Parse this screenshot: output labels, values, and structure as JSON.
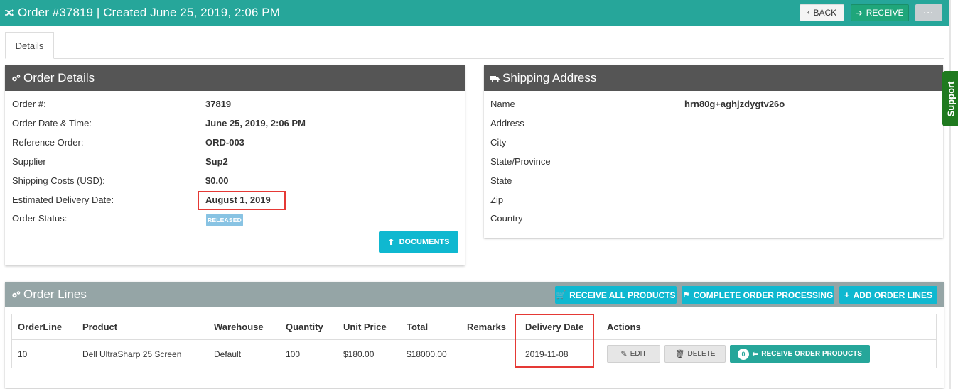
{
  "header": {
    "title": "Order #37819 | Created June 25, 2019, 2:06 PM",
    "back_label": "BACK",
    "receive_label": "RECEIVE",
    "more_label": "···",
    "accent_color": "#26a69a"
  },
  "tabs": [
    {
      "label": "Details"
    }
  ],
  "order_details": {
    "heading": "Order Details",
    "rows": [
      {
        "label": "Order #:",
        "value": "37819"
      },
      {
        "label": "Order Date & Time:",
        "value": "June 25, 2019, 2:06 PM"
      },
      {
        "label": "Reference Order:",
        "value": "ORD-003"
      },
      {
        "label": "Supplier",
        "value": "Sup2"
      },
      {
        "label": "Shipping Costs (USD):",
        "value": "$0.00"
      },
      {
        "label": "Estimated Delivery Date:",
        "value": "August 1, 2019"
      },
      {
        "label": "Order Status:",
        "value": ""
      }
    ],
    "status_badge": "RELEASED",
    "documents_label": "DOCUMENTS"
  },
  "shipping_address": {
    "heading": "Shipping Address",
    "rows": [
      {
        "label": "Name",
        "value": "hrn80g+aghjzdygtv26o"
      },
      {
        "label": "Address",
        "value": ""
      },
      {
        "label": "City",
        "value": ""
      },
      {
        "label": "State/Province",
        "value": ""
      },
      {
        "label": "State",
        "value": ""
      },
      {
        "label": "Zip",
        "value": ""
      },
      {
        "label": "Country",
        "value": ""
      }
    ]
  },
  "order_lines": {
    "heading": "Order Lines",
    "receive_all_label": "RECEIVE ALL PRODUCTS",
    "complete_label": "COMPLETE ORDER PROCESSING",
    "add_lines_label": "ADD ORDER LINES",
    "columns": [
      "OrderLine",
      "Product",
      "Warehouse",
      "Quantity",
      "Unit Price",
      "Total",
      "Remarks",
      "Delivery Date",
      "Actions"
    ],
    "rows": [
      {
        "orderline": "10",
        "product": "Dell UltraSharp 25 Screen",
        "warehouse": "Default",
        "quantity": "100",
        "unit_price": "$180.00",
        "total": "$18000.00",
        "remarks": "",
        "delivery_date": "2019-11-08"
      }
    ],
    "edit_label": "EDIT",
    "delete_label": "DELETE",
    "receive_count": "0",
    "receive_order_products_label": "RECEIVE ORDER PRODUCTS"
  },
  "support_label": "Support"
}
